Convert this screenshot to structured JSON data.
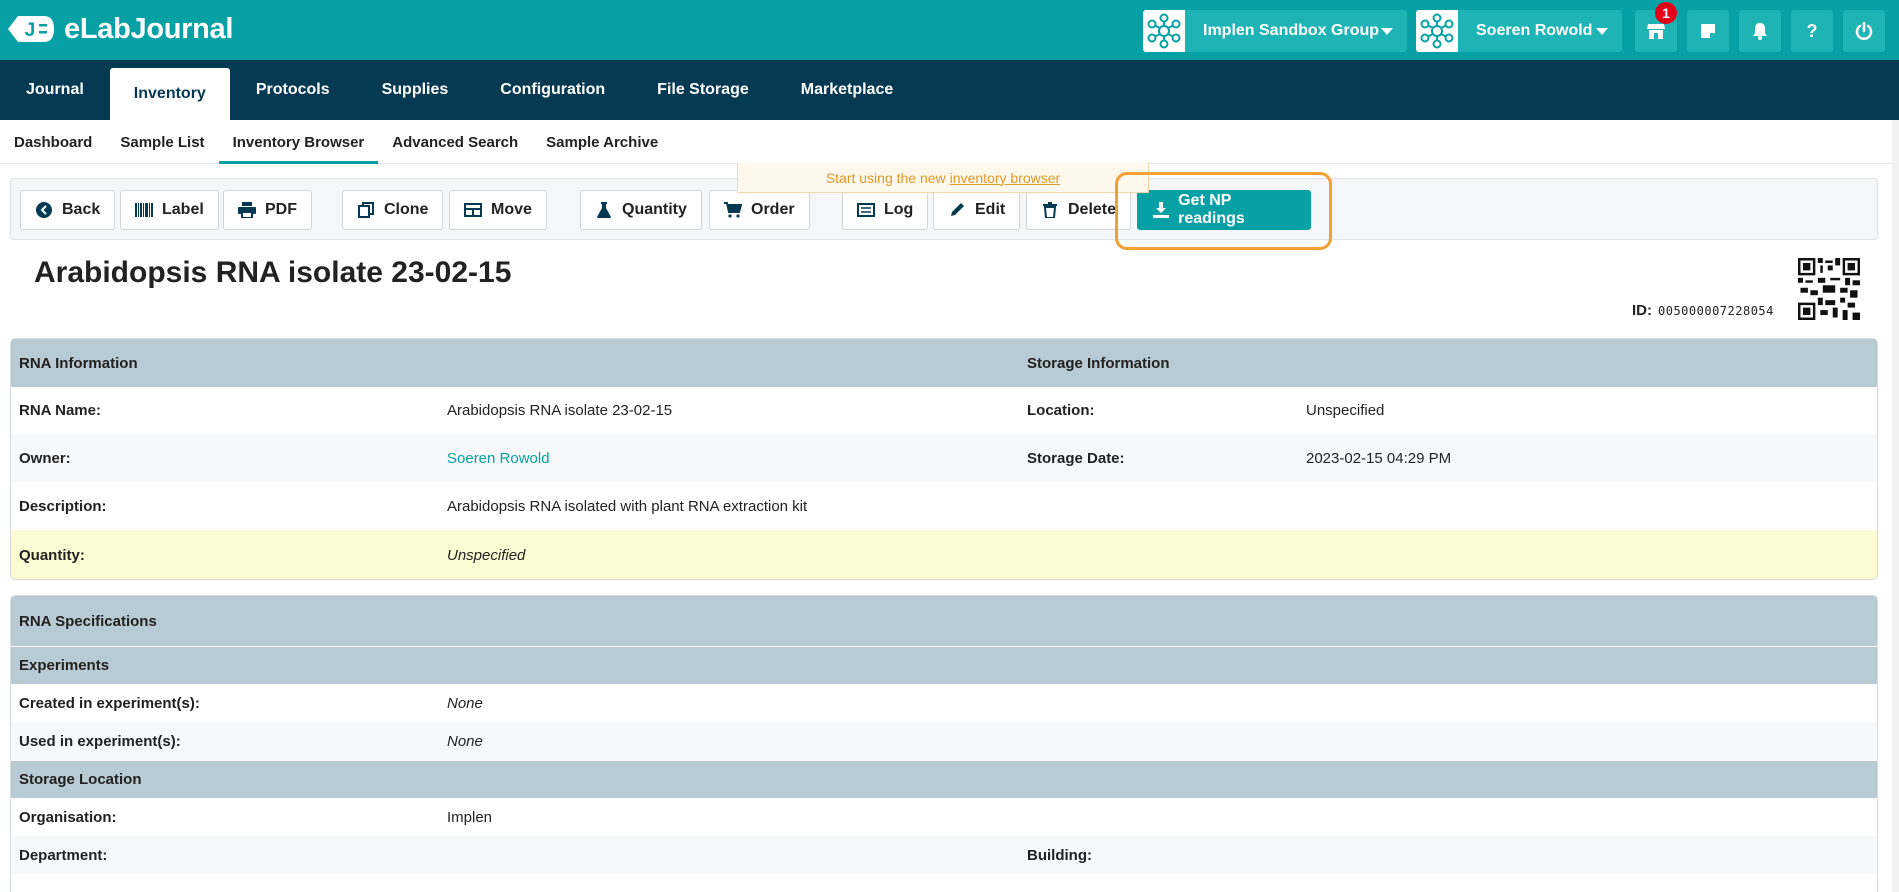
{
  "app": {
    "name": "eLabJournal",
    "logo_letter": "J"
  },
  "topbar": {
    "group_selector": "Implen Sandbox Group",
    "user_selector": "Soeren Rowold",
    "notification_count": "1",
    "help_label": "?"
  },
  "main_nav": [
    "Journal",
    "Inventory",
    "Protocols",
    "Supplies",
    "Configuration",
    "File Storage",
    "Marketplace"
  ],
  "sub_nav": [
    "Dashboard",
    "Sample List",
    "Inventory Browser",
    "Advanced Search",
    "Sample Archive"
  ],
  "notice": {
    "text": "Start using the new",
    "link": "inventory browser"
  },
  "toolbar": {
    "back": "Back",
    "label": "Label",
    "pdf": "PDF",
    "clone": "Clone",
    "move": "Move",
    "quantity": "Quantity",
    "order": "Order",
    "log": "Log",
    "edit": "Edit",
    "delete": "Delete",
    "get_np": "Get NP readings"
  },
  "sample": {
    "title": "Arabidopsis RNA isolate 23-02-15",
    "id_label": "ID:",
    "id_value": "005000007228054"
  },
  "info_table": {
    "left_header": "RNA Information",
    "right_header": "Storage Information",
    "rna_name_label": "RNA Name:",
    "rna_name": "Arabidopsis RNA isolate 23-02-15",
    "location_label": "Location:",
    "location": "Unspecified",
    "owner_label": "Owner:",
    "owner": "Soeren Rowold",
    "storage_date_label": "Storage Date:",
    "storage_date": "2023-02-15 04:29 PM",
    "description_label": "Description:",
    "description": "Arabidopsis RNA isolated with plant RNA extraction kit",
    "quantity_label": "Quantity:",
    "quantity": "Unspecified"
  },
  "spec_table": {
    "header": "RNA Specifications",
    "experiments_header": "Experiments",
    "created_label": "Created in experiment(s):",
    "created": "None",
    "used_label": "Used in experiment(s):",
    "used": "None",
    "storage_header": "Storage Location",
    "organisation_label": "Organisation:",
    "organisation": "Implen",
    "department_label": "Department:",
    "building_label": "Building:"
  },
  "colors": {
    "teal": "#07a1a5",
    "navy": "#063a52",
    "highlight": "#f2a033"
  }
}
